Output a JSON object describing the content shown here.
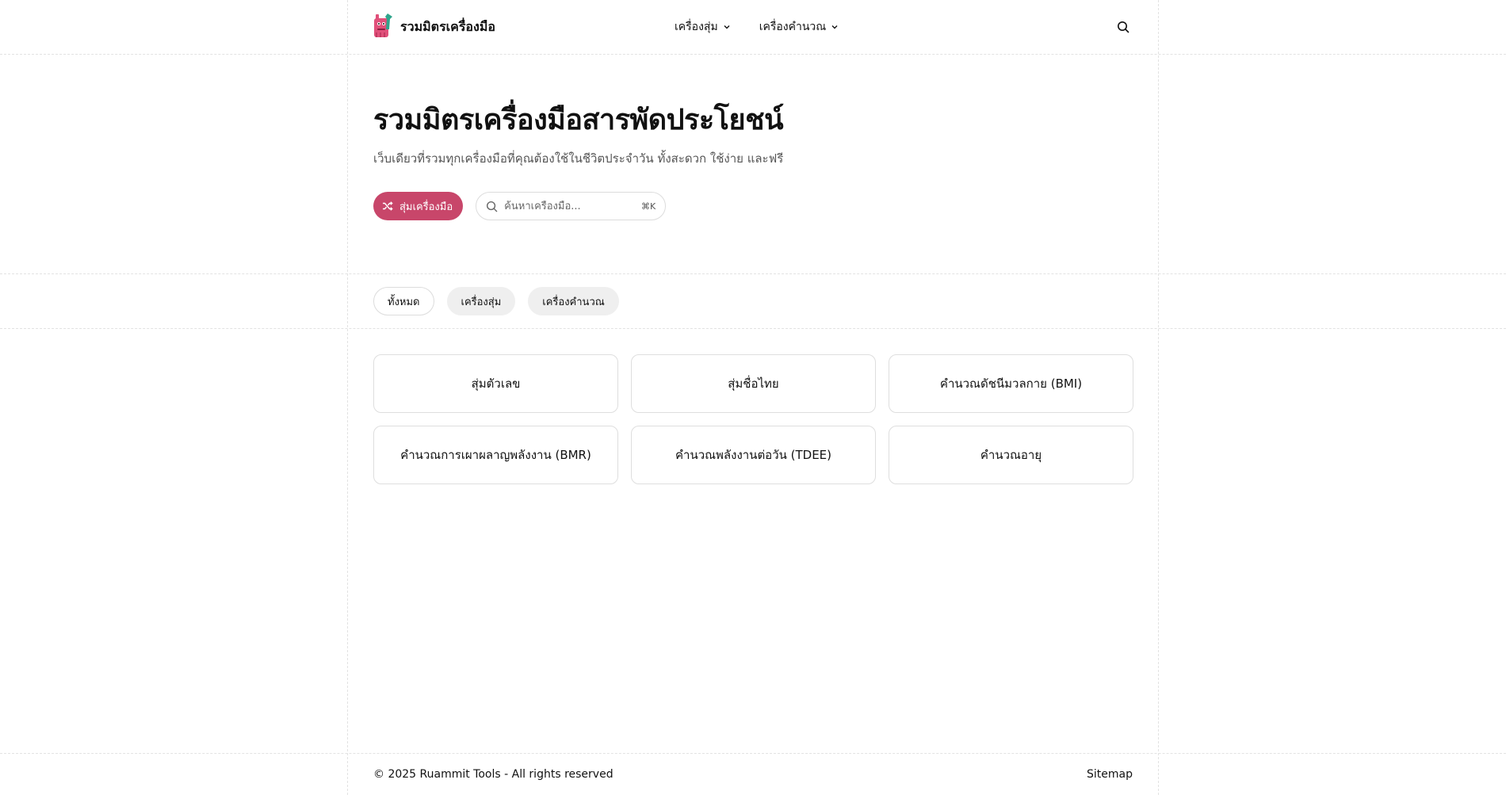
{
  "colors": {
    "accent": "#c8466a",
    "logo_pink": "#e0507a",
    "logo_teal": "#2fa58c"
  },
  "header": {
    "brand": "รวมมิตรเครื่องมือ",
    "nav": [
      {
        "label": "เครื่องสุ่ม",
        "icon": "chevron-down-icon"
      },
      {
        "label": "เครื่องคำนวณ",
        "icon": "chevron-down-icon"
      }
    ],
    "search_icon": "search-icon"
  },
  "hero": {
    "title": "รวมมิตรเครื่องมือสารพัดประโยชน์",
    "subtitle": "เว็บเดียวที่รวมทุกเครื่องมือที่คุณต้องใช้ในชีวิตประจำวัน ทั้งสะดวก ใช้ง่าย และฟรี",
    "random_button": "สุ่มเครื่องมือ",
    "search_placeholder": "ค้นหาเครื่องมือ...",
    "search_value": "",
    "shortcut": "⌘K"
  },
  "filters": [
    {
      "label": "ทั้งหมด",
      "active": true
    },
    {
      "label": "เครื่องสุ่ม",
      "active": false
    },
    {
      "label": "เครื่องคำนวณ",
      "active": false
    }
  ],
  "tools": [
    "สุ่มตัวเลข",
    "สุ่มชื่อไทย",
    "คำนวณดัชนีมวลกาย (BMI)",
    "คำนวณการเผาผลาญพลังงาน (BMR)",
    "คำนวณพลังงานต่อวัน (TDEE)",
    "คำนวณอายุ"
  ],
  "footer": {
    "copyright": "© 2025 Ruammit Tools - All rights reserved",
    "sitemap": "Sitemap"
  }
}
